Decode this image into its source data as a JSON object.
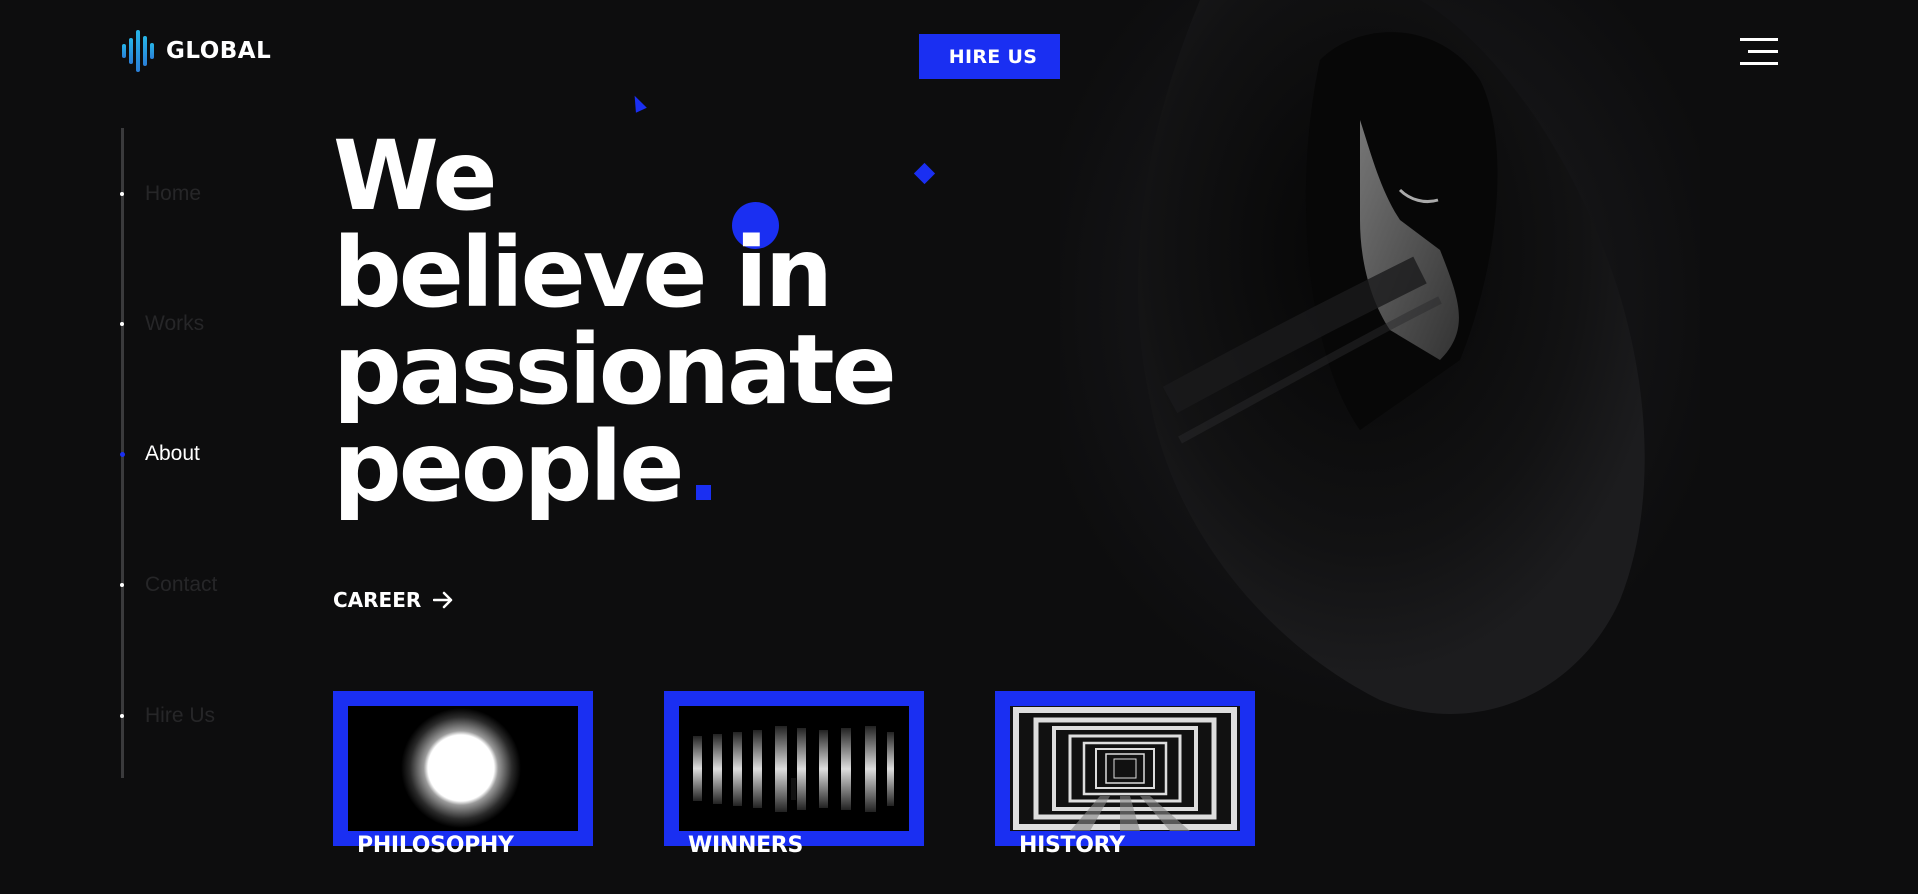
{
  "brand": {
    "name": "GLOBAL",
    "logo_icon": "audio-wave-icon"
  },
  "header": {
    "cta_label": "HIRE US",
    "menu_icon": "hamburger-icon"
  },
  "nav": {
    "items": [
      {
        "label": "Home",
        "active": false
      },
      {
        "label": "Works",
        "active": false
      },
      {
        "label": "About",
        "active": true
      },
      {
        "label": "Contact",
        "active": false
      },
      {
        "label": "Hire Us",
        "active": false
      }
    ]
  },
  "hero": {
    "lines": [
      "We",
      "believe in",
      "passionate",
      "people"
    ]
  },
  "career": {
    "label": "CAREER",
    "icon": "arrow-right-icon"
  },
  "cards": [
    {
      "label": "PHILOSOPHY"
    },
    {
      "label": "WINNERS"
    },
    {
      "label": "HISTORY"
    }
  ],
  "colors": {
    "background": "#0d0d0e",
    "accent": "#1a2ff2",
    "logo": "#27b6e8",
    "text": "#ffffff"
  }
}
